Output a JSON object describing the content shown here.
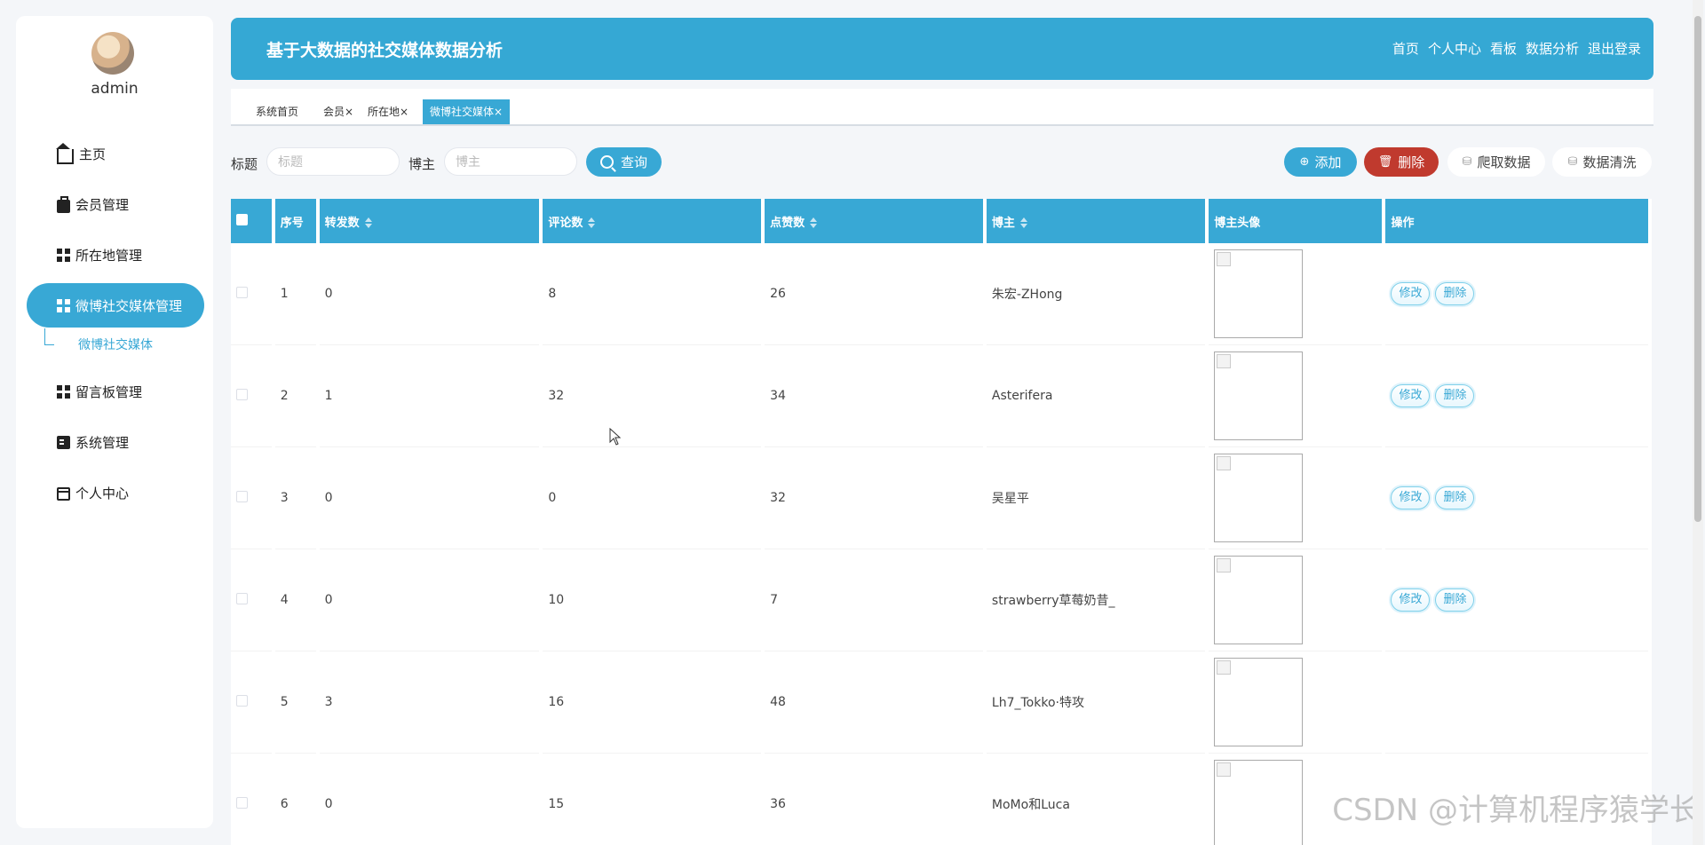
{
  "user": {
    "name": "admin"
  },
  "sidebar": {
    "items": [
      {
        "label": "主页",
        "icon": "home-icon"
      },
      {
        "label": "会员管理",
        "icon": "briefcase-icon"
      },
      {
        "label": "所在地管理",
        "icon": "grid-icon"
      },
      {
        "label": "微博社交媒体管理",
        "icon": "grid-icon",
        "active": true
      },
      {
        "label": "留言板管理",
        "icon": "grid-icon"
      },
      {
        "label": "系统管理",
        "icon": "clipboard-icon"
      },
      {
        "label": "个人中心",
        "icon": "card-icon"
      }
    ],
    "submenu": {
      "label": "微博社交媒体"
    }
  },
  "header": {
    "title": "基于大数据的社交媒体数据分析",
    "nav": [
      "首页",
      "个人中心",
      "看板",
      "数据分析",
      "退出登录"
    ]
  },
  "tabs": [
    {
      "label": "系统首页"
    },
    {
      "label": "会员×"
    },
    {
      "label": "所在地×"
    },
    {
      "label": "微博社交媒体×",
      "active": true
    }
  ],
  "search": {
    "title_label": "标题",
    "title_placeholder": "标题",
    "blogger_label": "博主",
    "blogger_placeholder": "博主",
    "query_button": "查询"
  },
  "actions": {
    "add": "添加",
    "delete": "删除",
    "crawl": "爬取数据",
    "clean": "数据清洗"
  },
  "table": {
    "headers": [
      "序号",
      "转发数",
      "评论数",
      "点赞数",
      "博主",
      "博主头像",
      "操作"
    ],
    "rows": [
      {
        "no": "1",
        "reposts": "0",
        "comments": "8",
        "likes": "26",
        "blogger": "朱宏-ZHong"
      },
      {
        "no": "2",
        "reposts": "1",
        "comments": "32",
        "likes": "34",
        "blogger": "Asterifera"
      },
      {
        "no": "3",
        "reposts": "0",
        "comments": "0",
        "likes": "32",
        "blogger": "吴星平"
      },
      {
        "no": "4",
        "reposts": "0",
        "comments": "10",
        "likes": "7",
        "blogger": "strawberry草莓奶昔_"
      },
      {
        "no": "5",
        "reposts": "3",
        "comments": "16",
        "likes": "48",
        "blogger": "Lh7_Tokko·特攻"
      },
      {
        "no": "6",
        "reposts": "0",
        "comments": "15",
        "likes": "36",
        "blogger": "MoMo和Luca"
      }
    ],
    "row_actions": {
      "edit": "修改",
      "delete": "删除"
    }
  },
  "watermark": "CSDN @计算机程序猿学长",
  "colors": {
    "primary": "#38a8d5",
    "danger": "#c03a2e"
  }
}
